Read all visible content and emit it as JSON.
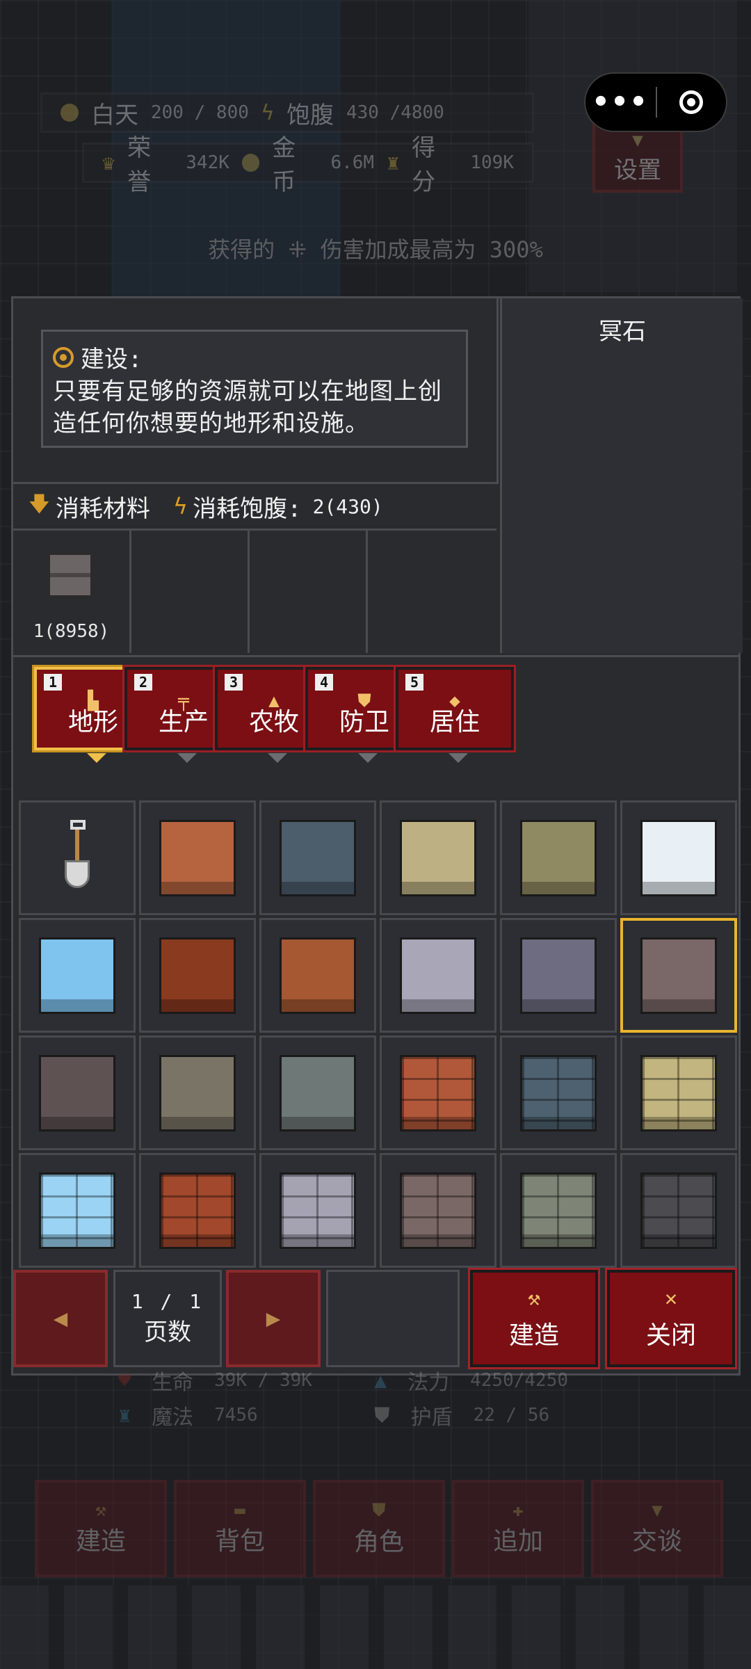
{
  "hud": {
    "daytime_label": "白天",
    "daytime_value": "200 / 800",
    "satiety_label": "饱腹",
    "satiety_value": "430 /4800",
    "honor_label": "荣誉",
    "honor_value": "342K",
    "gold_label": "金币",
    "gold_value": "6.6M",
    "score_label": "得分",
    "score_value": "109K",
    "settings_label": "设置"
  },
  "capsule": {
    "menu_icon": "more-dots-icon",
    "close_icon": "target-icon"
  },
  "bonus_text": "获得的 ⁜ 伤害加成最高为 300%",
  "build": {
    "title": "建设:",
    "description_line1": "只要有足够的资源就可以在地图上创",
    "description_line2": "造任何你想要的地形和设施。",
    "preview_name": "冥石",
    "cost_materials_label": "消耗材料",
    "cost_satiety_label": "消耗饱腹:",
    "cost_satiety_value": "2(430)",
    "material_count": "1(8958)"
  },
  "tabs": [
    {
      "num": "1",
      "label": "地形",
      "icon": "boot-icon",
      "active": true
    },
    {
      "num": "2",
      "label": "生产",
      "icon": "anvil-icon",
      "active": false
    },
    {
      "num": "3",
      "label": "农牧",
      "icon": "tree-icon",
      "active": false
    },
    {
      "num": "4",
      "label": "防卫",
      "icon": "shield-icon",
      "active": false
    },
    {
      "num": "5",
      "label": "居住",
      "icon": "diamond-icon",
      "active": false
    }
  ],
  "tiles": [
    {
      "name": "shovel",
      "c": "#000"
    },
    {
      "name": "red-earth",
      "c": "#b5643f"
    },
    {
      "name": "blue-slate",
      "c": "#4c5d6c"
    },
    {
      "name": "sandstone",
      "c": "#bdb183"
    },
    {
      "name": "olive-stone",
      "c": "#908a62"
    },
    {
      "name": "snow",
      "c": "#e8eff5"
    },
    {
      "name": "ice",
      "c": "#7fc3ef"
    },
    {
      "name": "lava-rock",
      "c": "#8a3a1f"
    },
    {
      "name": "copper-rock",
      "c": "#a55832"
    },
    {
      "name": "lavender-stone",
      "c": "#a9a6b8"
    },
    {
      "name": "eye-stone",
      "c": "#6e6c80"
    },
    {
      "name": "ghost-stone",
      "c": "#7a6767"
    },
    {
      "name": "cracked-stone",
      "c": "#5e5352"
    },
    {
      "name": "carved-stone",
      "c": "#7a7466"
    },
    {
      "name": "rune-stone",
      "c": "#6e7876"
    },
    {
      "name": "red-brick",
      "c": "#b1583a"
    },
    {
      "name": "blue-brick",
      "c": "#4e6170"
    },
    {
      "name": "sand-brick",
      "c": "#c2b580"
    },
    {
      "name": "ice-brick",
      "c": "#9ad3f3"
    },
    {
      "name": "clay-brick",
      "c": "#a2482d"
    },
    {
      "name": "grey-brick",
      "c": "#a5a2b2"
    },
    {
      "name": "dusk-brick",
      "c": "#7a6866"
    },
    {
      "name": "moss-brick",
      "c": "#7e8577"
    },
    {
      "name": "furnace-brick",
      "c": "#4b4b50"
    }
  ],
  "pager": {
    "page": "1 / 1",
    "label": "页数"
  },
  "actions": {
    "build_label": "建造",
    "close_label": "关闭"
  },
  "stats": {
    "hp_label": "生命",
    "hp_value": "39K / 39K",
    "mp_label": "法力",
    "mp_value": "4250/4250",
    "magic_label": "魔法",
    "magic_value": "7456",
    "shield_label": "护盾",
    "shield_value": "22 / 56"
  },
  "bottom_nav": [
    "建造",
    "背包",
    "角色",
    "追加",
    "交谈"
  ]
}
